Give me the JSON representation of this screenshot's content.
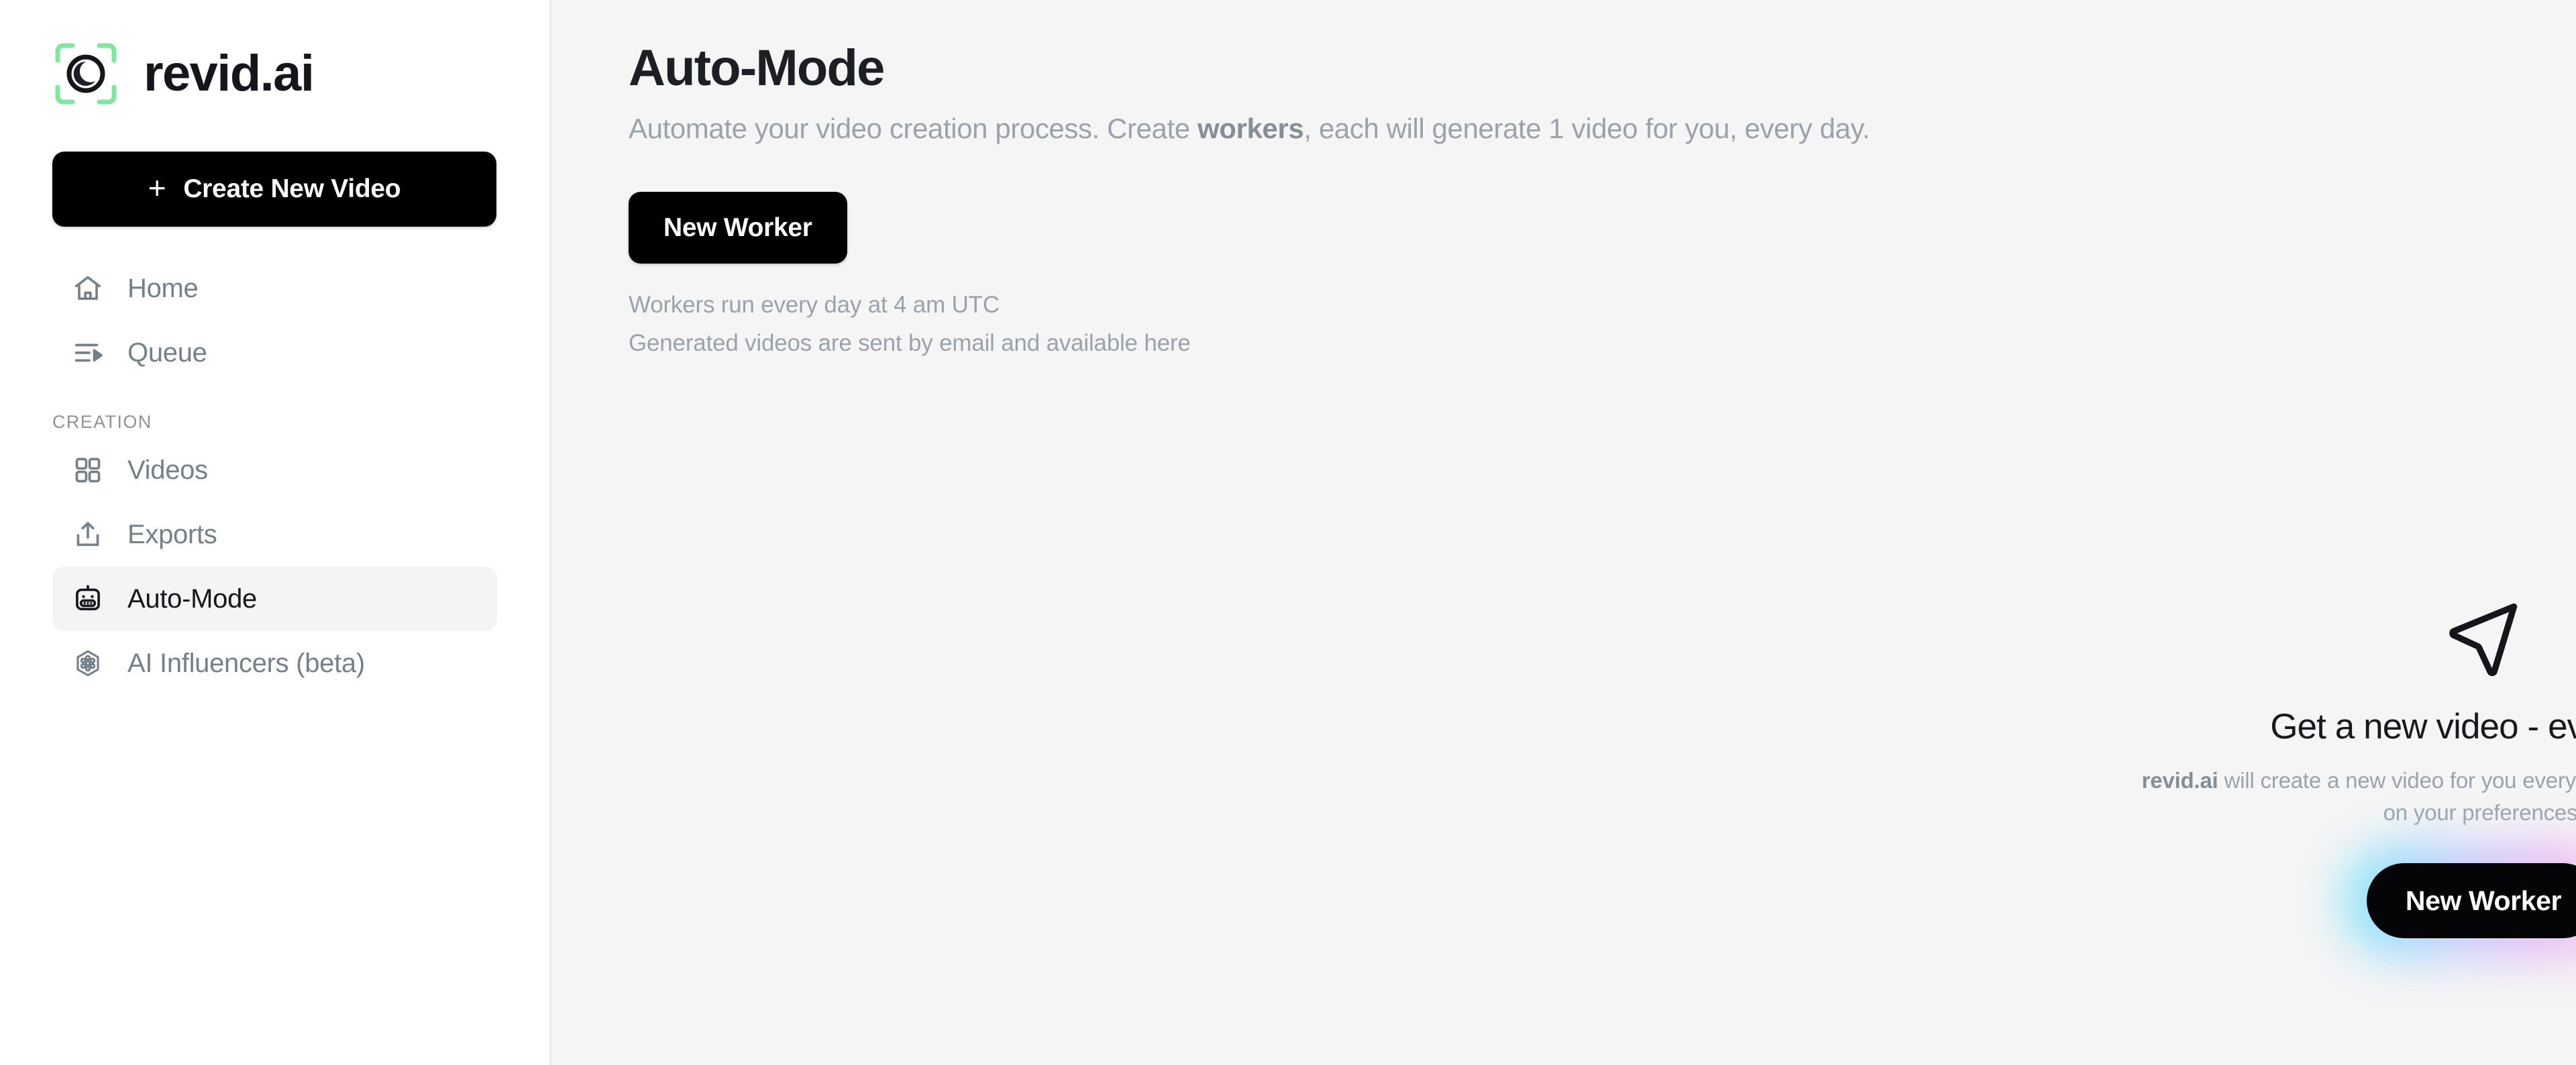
{
  "brand": {
    "wordmark": "revid.ai",
    "logo_icon": "eye-in-brackets-icon",
    "bracket_color": "#7ee89e",
    "mark_color": "#14161c"
  },
  "sidebar": {
    "create_button": {
      "label": "Create New Video",
      "icon": "plus-icon",
      "plus_glyph": "+"
    },
    "primary_items": [
      {
        "label": "Home",
        "icon": "home-icon",
        "active": false
      },
      {
        "label": "Queue",
        "icon": "queue-list-play-icon",
        "active": false
      }
    ],
    "section_label": "CREATION",
    "creation_items": [
      {
        "label": "Videos",
        "icon": "grid-icon",
        "active": false
      },
      {
        "label": "Exports",
        "icon": "upload-share-icon",
        "active": false
      },
      {
        "label": "Auto-Mode",
        "icon": "robot-icon",
        "active": true
      },
      {
        "label": "AI Influencers (beta)",
        "icon": "hexagon-molecule-icon",
        "active": false
      }
    ]
  },
  "main": {
    "title": "Auto-Mode",
    "subtitle_part1": "Automate your video creation process. Create ",
    "subtitle_bold": "workers",
    "subtitle_part2": ", each will generate 1 video for you, every day.",
    "new_worker_button": "New Worker",
    "helper_line_1": "Workers run every day at 4 am UTC",
    "helper_line_2": "Generated videos are sent by email and available here"
  },
  "empty_state": {
    "icon": "navigation-send-arrow-icon",
    "title": "Get a new video - every day",
    "desc_bold": "revid.ai",
    "desc_rest": " will create a new video for you every day, automatically, based on your preferences.",
    "cta_label": "New Worker"
  },
  "colors": {
    "page_background": "#f5f5f5",
    "sidebar_background": "#ffffff",
    "accent_green": "#7ee89e",
    "button_black": "#000000",
    "muted_text": "#9aa3ab",
    "active_pill": "#f4f4f5"
  }
}
